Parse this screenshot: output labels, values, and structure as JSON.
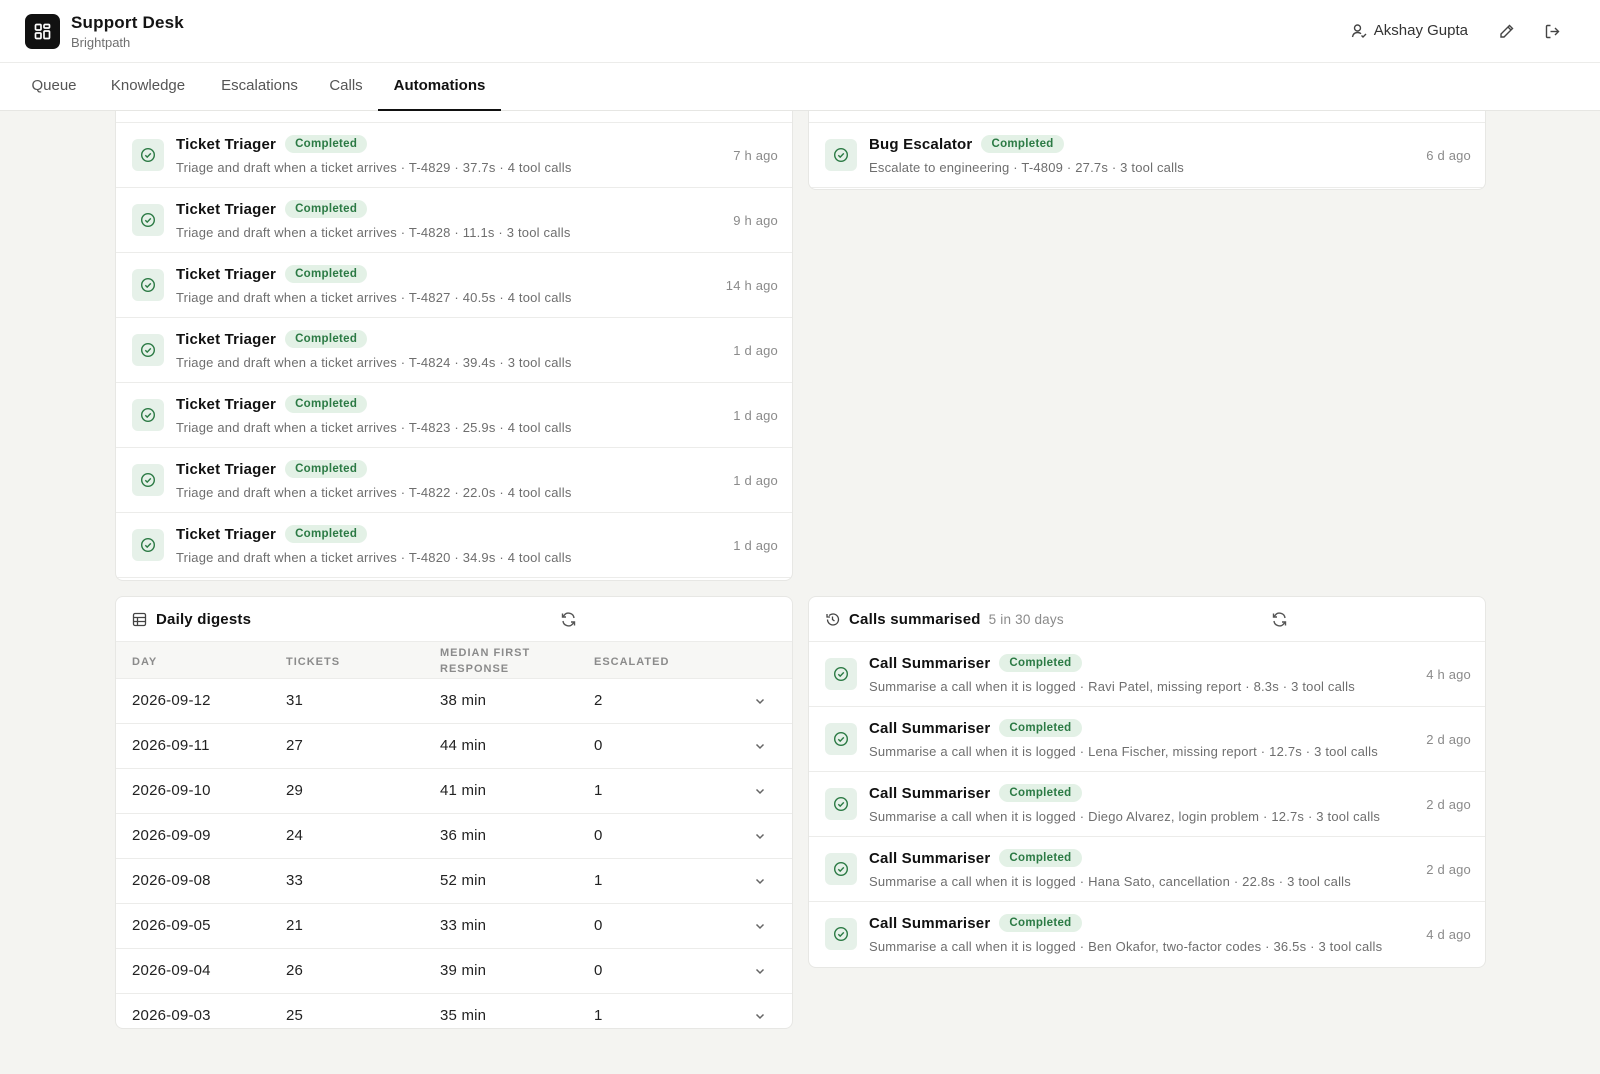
{
  "app": {
    "title": "Support Desk",
    "subtitle": "Brightpath"
  },
  "user": {
    "name": "Akshay Gupta"
  },
  "icons": {
    "logo": "grid-icon",
    "user": "user-icon",
    "edit": "pencil-icon",
    "logout": "logout-icon",
    "run": "check-circle-icon",
    "refresh": "refresh-icon",
    "table": "table-icon",
    "history": "history-icon",
    "expand": "chevron-down-icon"
  },
  "colors": {
    "accent": "#111111",
    "badge_bg": "#e3f1e6",
    "badge_text": "#2b7a44",
    "background": "#f4f4f1"
  },
  "tabs": [
    {
      "label": "Queue"
    },
    {
      "label": "Knowledge"
    },
    {
      "label": "Escalations"
    },
    {
      "label": "Calls"
    },
    {
      "label": "Automations",
      "active": true
    }
  ],
  "ticket_runs": [
    {
      "title": "Ticket Triager",
      "status": "Completed",
      "desc": "Triage and draft when a ticket arrives · T-4829 · 37.7s · 4 tool calls",
      "time": "7 h ago"
    },
    {
      "title": "Ticket Triager",
      "status": "Completed",
      "desc": "Triage and draft when a ticket arrives · T-4828 · 11.1s · 3 tool calls",
      "time": "9 h ago"
    },
    {
      "title": "Ticket Triager",
      "status": "Completed",
      "desc": "Triage and draft when a ticket arrives · T-4827 · 40.5s · 4 tool calls",
      "time": "14 h ago"
    },
    {
      "title": "Ticket Triager",
      "status": "Completed",
      "desc": "Triage and draft when a ticket arrives · T-4824 · 39.4s · 3 tool calls",
      "time": "1 d ago"
    },
    {
      "title": "Ticket Triager",
      "status": "Completed",
      "desc": "Triage and draft when a ticket arrives · T-4823 · 25.9s · 4 tool calls",
      "time": "1 d ago"
    },
    {
      "title": "Ticket Triager",
      "status": "Completed",
      "desc": "Triage and draft when a ticket arrives · T-4822 · 22.0s · 4 tool calls",
      "time": "1 d ago"
    },
    {
      "title": "Ticket Triager",
      "status": "Completed",
      "desc": "Triage and draft when a ticket arrives · T-4820 · 34.9s · 4 tool calls",
      "time": "1 d ago"
    }
  ],
  "escalation_runs": [
    {
      "title": "Bug Escalator",
      "status": "Completed",
      "desc": "Escalate to engineering · T-4809 · 27.7s · 3 tool calls",
      "time": "6 d ago"
    }
  ],
  "digests": {
    "title": "Daily digests",
    "columns": {
      "day": "DAY",
      "tickets": "TICKETS",
      "median_line1": "MEDIAN FIRST",
      "median_line2": "RESPONSE",
      "escalated": "ESCALATED"
    },
    "rows": [
      {
        "day": "2026-09-12",
        "tickets": "31",
        "median": "38 min",
        "escalated": "2"
      },
      {
        "day": "2026-09-11",
        "tickets": "27",
        "median": "44 min",
        "escalated": "0"
      },
      {
        "day": "2026-09-10",
        "tickets": "29",
        "median": "41 min",
        "escalated": "1"
      },
      {
        "day": "2026-09-09",
        "tickets": "24",
        "median": "36 min",
        "escalated": "0"
      },
      {
        "day": "2026-09-08",
        "tickets": "33",
        "median": "52 min",
        "escalated": "1"
      },
      {
        "day": "2026-09-05",
        "tickets": "21",
        "median": "33 min",
        "escalated": "0"
      },
      {
        "day": "2026-09-04",
        "tickets": "26",
        "median": "39 min",
        "escalated": "0"
      },
      {
        "day": "2026-09-03",
        "tickets": "25",
        "median": "35 min",
        "escalated": "1"
      }
    ]
  },
  "calls": {
    "title": "Calls summarised",
    "subtitle": "5 in 30 days",
    "runs": [
      {
        "title": "Call Summariser",
        "status": "Completed",
        "desc": "Summarise a call when it is logged · Ravi Patel, missing report · 8.3s · 3 tool calls",
        "time": "4 h ago"
      },
      {
        "title": "Call Summariser",
        "status": "Completed",
        "desc": "Summarise a call when it is logged · Lena Fischer, missing report · 12.7s · 3 tool calls",
        "time": "2 d ago"
      },
      {
        "title": "Call Summariser",
        "status": "Completed",
        "desc": "Summarise a call when it is logged · Diego Alvarez, login problem · 12.7s · 3 tool calls",
        "time": "2 d ago"
      },
      {
        "title": "Call Summariser",
        "status": "Completed",
        "desc": "Summarise a call when it is logged · Hana Sato, cancellation · 22.8s · 3 tool calls",
        "time": "2 d ago"
      },
      {
        "title": "Call Summariser",
        "status": "Completed",
        "desc": "Summarise a call when it is logged · Ben Okafor, two-factor codes · 36.5s · 3 tool calls",
        "time": "4 d ago"
      }
    ]
  }
}
